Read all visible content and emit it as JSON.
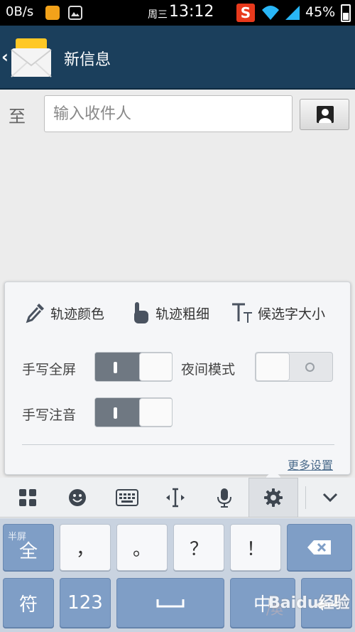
{
  "status_bar": {
    "net_speed": "0B/s",
    "weekday": "周三",
    "time": "13:12",
    "sogou_label": "S",
    "battery": "45%"
  },
  "title_bar": {
    "title": "新信息",
    "icon": "envelope-icon"
  },
  "recipient": {
    "to_label": "至",
    "placeholder": "输入收件人"
  },
  "popup": {
    "options": [
      {
        "label": "轨迹颜色",
        "icon": "dropper-icon"
      },
      {
        "label": "轨迹粗细",
        "icon": "finger-icon"
      },
      {
        "label": "候选字大小",
        "icon": "text-size-icon"
      }
    ],
    "fullscreen_label": "手写全屏",
    "fullscreen_on": true,
    "night_label": "夜间模式",
    "night_on": false,
    "pinyin_label": "手写注音",
    "pinyin_on": true,
    "more_settings": "更多设置"
  },
  "toolbar": {
    "items": [
      "grid-icon",
      "emoji-icon",
      "keyboard-icon",
      "cursor-icon",
      "mic-icon",
      "gear-icon",
      "chevron-down-icon"
    ],
    "active": "gear-icon"
  },
  "keyboard": {
    "row1": {
      "half_full_sub": "半屏",
      "half_full_main": "全",
      "k1": "，",
      "k2": "。",
      "k3": "？",
      "k4": "！"
    },
    "row2": {
      "symbols": "符",
      "numbers": "123",
      "lang_main": "中",
      "lang_sub": "/英"
    }
  },
  "watermark": "Baidu经验",
  "colors": {
    "title_bar": "#1b3f5c",
    "key_blue": "#7f9ec6",
    "toggle_on": "#6f7882"
  }
}
